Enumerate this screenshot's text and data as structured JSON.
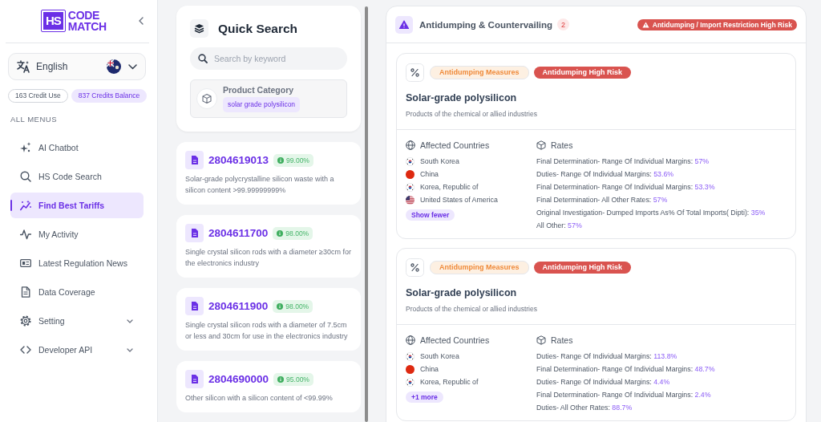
{
  "sidebar": {
    "logo": {
      "badge": "HS",
      "line_1": "CODE",
      "line_2": "MATCH"
    },
    "language": {
      "value": "English"
    },
    "credits": [
      {
        "text": "163 Credit Use",
        "kind": "usage"
      },
      {
        "text": "837 Credits Balance",
        "kind": "balance"
      }
    ],
    "menu_heading": "ALL MENUS",
    "menu": [
      {
        "label": "AI Chatbot",
        "kind": "link",
        "selected": false
      },
      {
        "label": "HS Code Search",
        "kind": "link",
        "selected": false
      },
      {
        "label": "Find Best Tariffs",
        "kind": "link",
        "selected": true
      },
      {
        "label": "My Activity",
        "kind": "link",
        "selected": false
      },
      {
        "label": "Latest Regulation News",
        "kind": "link",
        "selected": false
      },
      {
        "label": "Data Coverage",
        "kind": "link",
        "selected": false
      },
      {
        "label": "Setting",
        "kind": "group",
        "selected": false
      },
      {
        "label": "Developer API",
        "kind": "group",
        "selected": false
      }
    ]
  },
  "quick_search": {
    "title": "Quick Search",
    "search": {
      "placeholder": "Search by keyword"
    },
    "category": {
      "label": "Product Category",
      "tag": "solar grade polysilicon"
    }
  },
  "results": [
    {
      "code": "2804619013",
      "score": "99.00%",
      "description": "Solar-grade polycrystalline silicon waste with a silicon content >99.99999999%"
    },
    {
      "code": "2804611700",
      "score": "98.00%",
      "description": "Single crystal silicon rods with a diameter ≥30cm for the electronics industry"
    },
    {
      "code": "2804611900",
      "score": "98.00%",
      "description": "Single crystal silicon rods with a diameter of 7.5cm or less and 30cm for use in the electronics industry"
    },
    {
      "code": "2804690000",
      "score": "95.00%",
      "description": "Other silicon with a silicon content of <99.99%"
    }
  ],
  "measures_panel": {
    "title": "Antidumping & Countervailing",
    "count": "2",
    "risk_badge": "Antidumping / Import Restriction High Risk",
    "measures": [
      {
        "tags": [
          {
            "text": "Antidumping Measures",
            "kind": "measure"
          },
          {
            "text": "Antidumping High Risk",
            "kind": "risk"
          }
        ],
        "title": "Solar-grade polysilicon",
        "category": "Products of the chemical or allied industries",
        "countries_heading": "Affected Countries",
        "countries": [
          {
            "name": "South Korea",
            "kind": "kr"
          },
          {
            "name": "China",
            "kind": "cn"
          },
          {
            "name": "Korea, Republic of",
            "kind": "kr"
          },
          {
            "name": "United States of America",
            "kind": "us"
          }
        ],
        "toggle": "Show fewer",
        "rates_heading": "Rates",
        "rates": [
          {
            "label": "Final Determination- Range Of Individual Margins:",
            "value": "57%"
          },
          {
            "label": "Duties- Range Of Individual Margins:",
            "value": "53.6%"
          },
          {
            "label": "Final Determination- Range Of Individual Margins:",
            "value": "53.3%"
          },
          {
            "label": "Final Determination- All Other Rates:",
            "value": "57%"
          },
          {
            "label": "Original Investigation- Dumped Imports As% Of Total Imports( Dipti):",
            "value": "35%"
          },
          {
            "label": "All Other:",
            "value": "57%"
          }
        ]
      },
      {
        "tags": [
          {
            "text": "Antidumping Measures",
            "kind": "measure"
          },
          {
            "text": "Antidumping High Risk",
            "kind": "risk"
          }
        ],
        "title": "Solar-grade polysilicon",
        "category": "Products of the chemical or allied industries",
        "countries_heading": "Affected Countries",
        "countries": [
          {
            "name": "South Korea",
            "kind": "kr"
          },
          {
            "name": "China",
            "kind": "cn"
          },
          {
            "name": "Korea, Republic of",
            "kind": "kr"
          }
        ],
        "toggle": "+1 more",
        "rates_heading": "Rates",
        "rates": [
          {
            "label": "Duties- Range Of Individual Margins:",
            "value": "113.8%"
          },
          {
            "label": "Final Determination- Range Of Individual Margins:",
            "value": "48.7%"
          },
          {
            "label": "Duties- Range Of Individual Margins:",
            "value": "4.4%"
          },
          {
            "label": "Final Determination- Range Of Individual Margins:",
            "value": "2.4%"
          },
          {
            "label": "Duties- All Other Rates:",
            "value": "88.7%"
          }
        ]
      }
    ]
  }
}
